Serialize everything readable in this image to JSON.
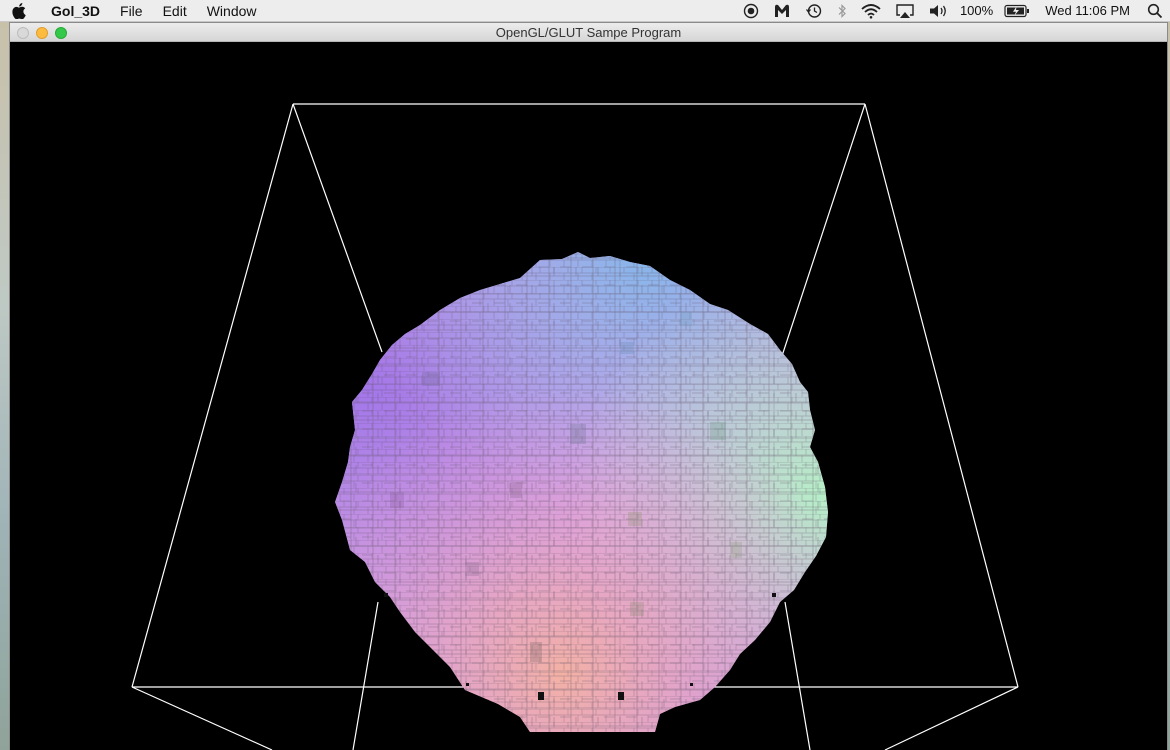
{
  "menubar": {
    "app_name": "Gol_3D",
    "menus": [
      "File",
      "Edit",
      "Window"
    ],
    "status": {
      "battery_percent": "100%",
      "clock": "Wed 11:06 PM"
    },
    "icons": [
      "apple-icon",
      "record-icon",
      "malwarebytes-icon",
      "time-machine-icon",
      "bluetooth-icon",
      "wifi-icon",
      "airplay-icon",
      "volume-icon",
      "battery-icon",
      "spotlight-icon"
    ]
  },
  "window": {
    "title": "OpenGL/GLUT Sampe Program"
  },
  "scene": {
    "background": "#000000",
    "wireframe_color": "#ffffff",
    "sphere_colors": [
      "#9d88ee",
      "#8fb6ea",
      "#9ff0c8",
      "#e38fe0",
      "#f0aab0",
      "#d9e3b0"
    ]
  }
}
